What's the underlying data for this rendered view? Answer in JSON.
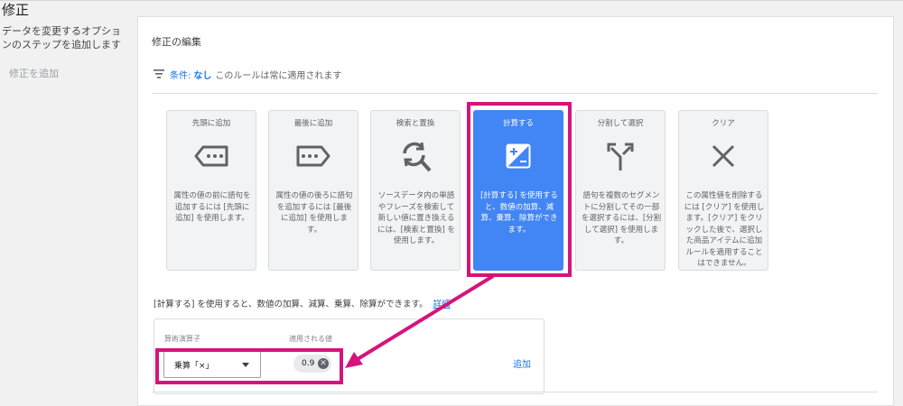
{
  "page": {
    "title": "修正"
  },
  "sidebar": {
    "description": "データを変更するオプションのステップを追加します",
    "add_label": "修正を追加"
  },
  "editor": {
    "title": "修正の編集",
    "condition_label": "条件:",
    "condition_value": "なし",
    "condition_text": "このルールは常に適用されます"
  },
  "cards": [
    {
      "title": "先頭に追加",
      "icon": "prepend-tag-icon",
      "desc": "属性の値の前に語句を追加するには [先頭に追加] を使用します。"
    },
    {
      "title": "最後に追加",
      "icon": "append-tag-icon",
      "desc": "属性の値の後ろに語句を追加するには [最後に追加] を使用します。"
    },
    {
      "title": "検索と置換",
      "icon": "find-replace-icon",
      "desc": "ソースデータ内の単語やフレーズを検索して新しい値に置き換えるには、[検索と置換] を使用します。"
    },
    {
      "title": "計算する",
      "icon": "calculate-icon",
      "desc": "[計算する] を使用すると、数値の加算、減算、乗算、除算ができます。"
    },
    {
      "title": "分割して選択",
      "icon": "split-icon",
      "desc": "語句を複数のセグメントに分割してその一部を選択するには、[分割して選択] を使用します。"
    },
    {
      "title": "クリア",
      "icon": "close-icon",
      "desc": "この属性値を削除するには [クリア] を使用します。[クリア] をクリックした後で、選択した商品アイテムに追加ルールを適用することはできません。"
    }
  ],
  "info": {
    "text": "[計算する] を使用すると、数値の加算、減算、乗算、除算ができます。",
    "link": "詳細"
  },
  "calc": {
    "operator_label": "算術演算子",
    "operator_value": "乗算「×」",
    "value_label": "適用される値",
    "value": "0.9",
    "add_label": "追加"
  },
  "colors": {
    "accent": "#4285f4",
    "highlight": "#d6137c",
    "link": "#1a73e8"
  }
}
